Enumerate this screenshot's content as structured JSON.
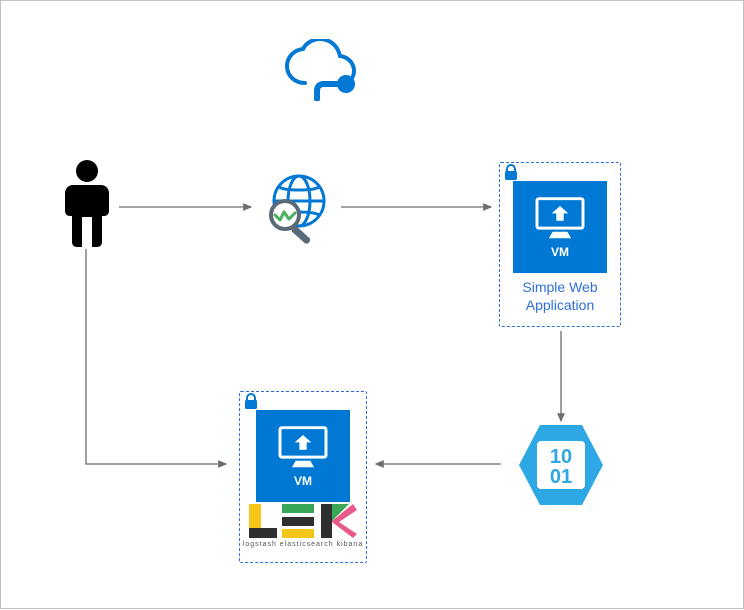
{
  "nodes": {
    "cloud": {
      "name": "cloud"
    },
    "person": {
      "name": "user"
    },
    "search_globe": {
      "name": "web-lookup"
    },
    "webapp_box": {
      "vm_label": "VM",
      "caption": "Simple Web\nApplication"
    },
    "lek_box": {
      "vm_label": "VM",
      "lek_sub": "logstash elasticsearch kibana"
    },
    "hex_data": {
      "text_top": "10",
      "text_bot": "01"
    }
  },
  "colors": {
    "azure_blue": "#0078d4",
    "light_blue": "#2ea8e5",
    "border_blue": "#2e6fd8",
    "arrow_gray": "#6d6d6d",
    "lek_yellow": "#f5c518",
    "lek_dark": "#2f2f2f",
    "lek_green": "#3aa757",
    "lek_pink": "#e85a8a"
  },
  "arrows": [
    {
      "from": "person",
      "to": "search_globe"
    },
    {
      "from": "search_globe",
      "to": "webapp_box"
    },
    {
      "from": "webapp_box",
      "to": "hex_data"
    },
    {
      "from": "hex_data",
      "to": "lek_box"
    },
    {
      "from": "person",
      "to": "lek_box"
    }
  ]
}
